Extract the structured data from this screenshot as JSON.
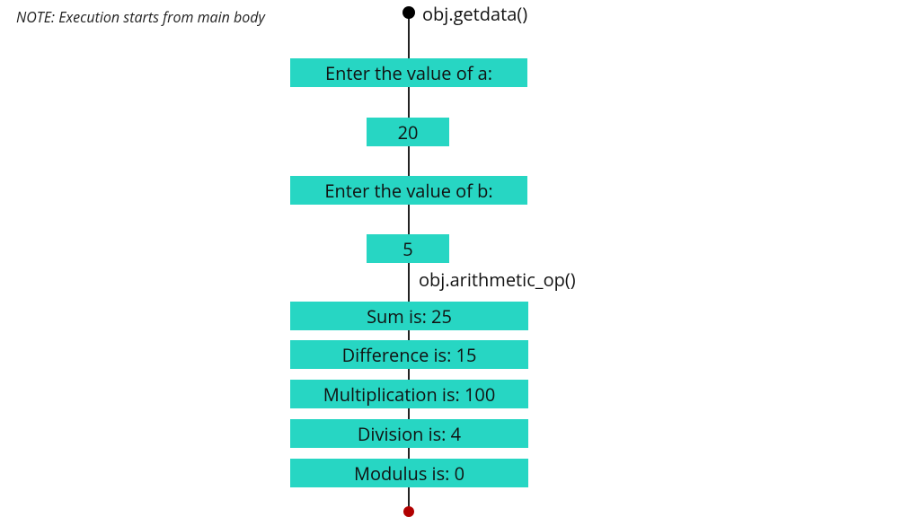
{
  "note": "NOTE: Execution starts from main body",
  "call1": "obj.getdata()",
  "call2": "obj.arithmetic_op()",
  "boxes": {
    "prompt_a": "Enter the value of a:",
    "val_a": "20",
    "prompt_b": "Enter the value of b:",
    "val_b": "5",
    "sum": "Sum is: 25",
    "diff": "Difference is: 15",
    "mult": "Multiplication is: 100",
    "div": "Division is: 4",
    "mod": "Modulus is: 0"
  },
  "colors": {
    "box": "#27d6c3",
    "end": "#b10000"
  }
}
